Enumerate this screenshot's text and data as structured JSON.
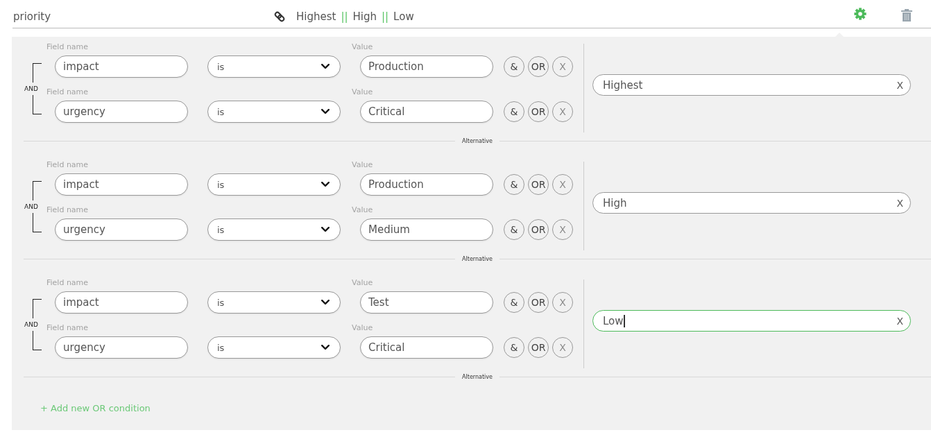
{
  "header": {
    "title": "priority",
    "summary": [
      {
        "kind": "value",
        "text": "Highest"
      },
      {
        "kind": "separator",
        "text": "||"
      },
      {
        "kind": "value",
        "text": "High"
      },
      {
        "kind": "separator",
        "text": "||"
      },
      {
        "kind": "value",
        "text": "Low"
      }
    ]
  },
  "alternatives": [
    {
      "joiner": "AND",
      "conditions": [
        {
          "field_label": "Field name",
          "field": "impact",
          "operator": "is",
          "value_label": "Value",
          "value": "Production",
          "actions": [
            {
              "kind": "and",
              "label": "&"
            },
            {
              "kind": "or",
              "label": "OR"
            },
            {
              "kind": "remove",
              "label": "X"
            }
          ]
        },
        {
          "field_label": "Field name",
          "field": "urgency",
          "operator": "is",
          "value_label": "Value",
          "value": "Critical",
          "actions": [
            {
              "kind": "and",
              "label": "&"
            },
            {
              "kind": "or",
              "label": "OR"
            },
            {
              "kind": "remove",
              "label": "X"
            }
          ]
        }
      ],
      "result": {
        "value": "Highest",
        "clear": "X",
        "focused": false
      },
      "divider": "Alternative"
    },
    {
      "joiner": "AND",
      "conditions": [
        {
          "field_label": "Field name",
          "field": "impact",
          "operator": "is",
          "value_label": "Value",
          "value": "Production",
          "actions": [
            {
              "kind": "and",
              "label": "&"
            },
            {
              "kind": "or",
              "label": "OR"
            },
            {
              "kind": "remove",
              "label": "X"
            }
          ]
        },
        {
          "field_label": "Field name",
          "field": "urgency",
          "operator": "is",
          "value_label": "Value",
          "value": "Medium",
          "actions": [
            {
              "kind": "and",
              "label": "&"
            },
            {
              "kind": "or",
              "label": "OR"
            },
            {
              "kind": "remove",
              "label": "X"
            }
          ]
        }
      ],
      "result": {
        "value": "High",
        "clear": "X",
        "focused": false
      },
      "divider": "Alternative"
    },
    {
      "joiner": "AND",
      "conditions": [
        {
          "field_label": "Field name",
          "field": "impact",
          "operator": "is",
          "value_label": "Value",
          "value": "Test",
          "actions": [
            {
              "kind": "and",
              "label": "&"
            },
            {
              "kind": "or",
              "label": "OR"
            },
            {
              "kind": "remove",
              "label": "X"
            }
          ]
        },
        {
          "field_label": "Field name",
          "field": "urgency",
          "operator": "is",
          "value_label": "Value",
          "value": "Critical",
          "actions": [
            {
              "kind": "and",
              "label": "&"
            },
            {
              "kind": "or",
              "label": "OR"
            },
            {
              "kind": "remove",
              "label": "X"
            }
          ]
        }
      ],
      "result": {
        "value": "Low",
        "clear": "X",
        "focused": true
      },
      "divider": "Alternative"
    }
  ],
  "add_condition": "+ Add new OR condition"
}
